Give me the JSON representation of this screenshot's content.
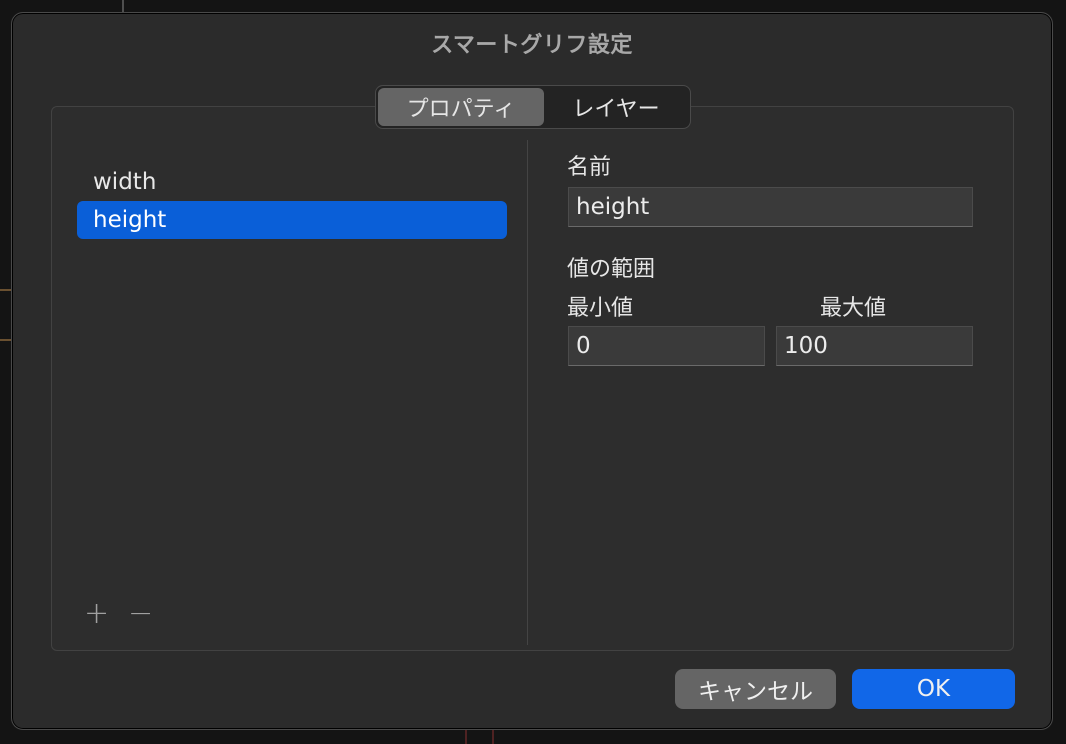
{
  "window": {
    "title": "スマートグリフ設定"
  },
  "tabs": [
    {
      "label": "プロパティ",
      "selected": true
    },
    {
      "label": "レイヤー",
      "selected": false
    }
  ],
  "properties": [
    {
      "name": "width",
      "selected": false
    },
    {
      "name": "height",
      "selected": true
    }
  ],
  "list_controls": {
    "add": "+",
    "remove": "−"
  },
  "detail": {
    "name_label": "名前",
    "name_value": "height",
    "range_label": "値の範囲",
    "min_label": "最小値",
    "max_label": "最大値",
    "min_value": "0",
    "max_value": "100"
  },
  "buttons": {
    "cancel": "キャンセル",
    "ok": "OK"
  },
  "colors": {
    "accent": "#1167e8",
    "selection": "#0a5fd8"
  }
}
